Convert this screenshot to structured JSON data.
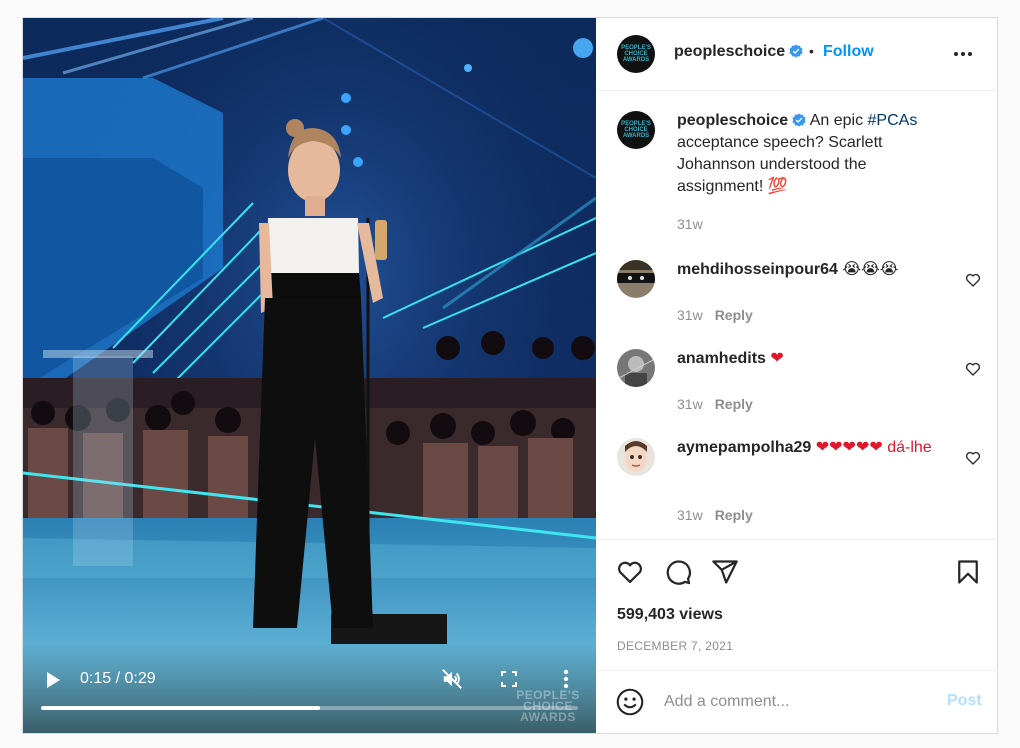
{
  "video": {
    "time": "0:15 / 0:29",
    "progress_fraction": 0.52,
    "watermark": [
      "PEOPLE'S",
      "CHOICE",
      "AWARDS"
    ]
  },
  "header": {
    "username": "peopleschoice",
    "dot": "•",
    "follow": "Follow",
    "avatar_text": [
      "PEOPLE'S",
      "CHOICE",
      "AWARDS"
    ]
  },
  "caption": {
    "username": "peopleschoice",
    "text_before": "An epic ",
    "hashtag": "#PCAs",
    "text_after": " acceptance speech? Scarlett Johannson understood the assignment! ",
    "emoji": "💯",
    "time": "31w"
  },
  "comments": [
    {
      "username": "mehdihosseinpour64",
      "text": "😭😭😭",
      "time": "31w",
      "reply": "Reply"
    },
    {
      "username": "anamhedits",
      "text": "❤",
      "time": "31w",
      "reply": "Reply"
    },
    {
      "username": "aymepampolha29",
      "text": "❤❤❤❤❤ dá-lhe",
      "time": "31w",
      "reply": "Reply"
    }
  ],
  "stats": {
    "views": "599,403 views",
    "date": "DECEMBER 7, 2021"
  },
  "add_comment": {
    "placeholder": "Add a comment...",
    "post": "Post"
  },
  "colors": {
    "accent": "#0095f6",
    "hashtag": "#00376b",
    "muted": "#8e8e8e",
    "post_disabled": "#b2dffc",
    "heart_emoji": "#e0162b"
  },
  "icons": [
    "play-icon",
    "mute-icon",
    "fullscreen-icon",
    "vertical-more-icon",
    "verified-icon",
    "more-horizontal-icon",
    "heart-icon",
    "comment-icon",
    "share-icon",
    "bookmark-icon",
    "emoji-icon"
  ]
}
